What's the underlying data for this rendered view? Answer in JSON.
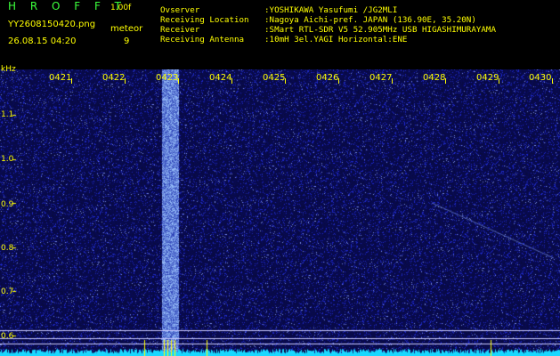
{
  "header": {
    "brand": "H R O F F T",
    "version": "1.00f",
    "filename": "YY2608150420.png",
    "datetime": "26.08.15 04:20",
    "meteor_label": "meteor",
    "meteor_count": "9"
  },
  "info": [
    {
      "label": "Ovserver",
      "value": ":YOSHIKAWA Yasufumi /JG2MLI"
    },
    {
      "label": "Receiving Location",
      "value": ":Nagoya Aichi-pref. JAPAN (136.90E, 35.20N)"
    },
    {
      "label": "Receiver",
      "value": ":SMart RTL-SDR V5 52.905MHz USB HIGASHIMURAYAMA"
    },
    {
      "label": "Receiving Antenna",
      "value": ":10mH 3el.YAGI Horizontal:ENE"
    }
  ],
  "axis": {
    "unit": "kHz",
    "y_ticks": [
      "1.1",
      "1.0",
      "0.9",
      "0.8",
      "0.7",
      "0.6"
    ],
    "x_ticks": [
      "0421",
      "0422",
      "0423",
      "0424",
      "0425",
      "0426",
      "0427",
      "0428",
      "0429",
      "0430"
    ]
  },
  "colors": {
    "background": "#000000",
    "waterfall_bg": "#0a0c4a",
    "label": "#ffff00",
    "brand": "#3cff3c",
    "signal": "#6fd8ff"
  }
}
